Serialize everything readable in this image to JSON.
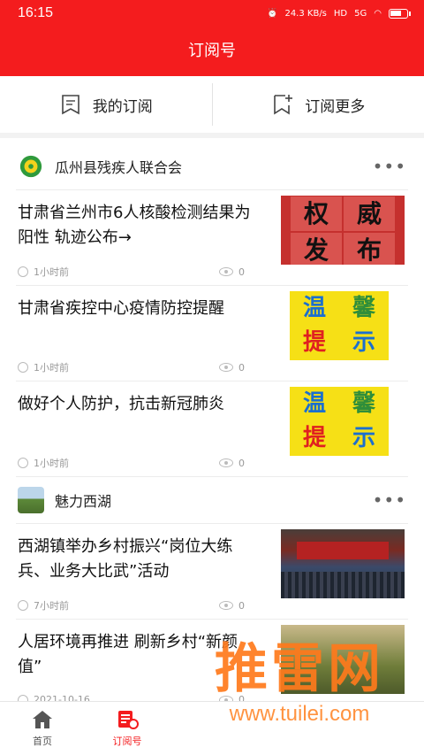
{
  "status_bar": {
    "time": "16:15",
    "net_speed": "24.3 KB/s",
    "hd": "HD",
    "signal": "5G",
    "battery": "76"
  },
  "header": {
    "title": "订阅号"
  },
  "subbar": {
    "my_subscriptions": "我的订阅",
    "subscribe_more": "订阅更多"
  },
  "sources": [
    {
      "name": "瓜州县残疾人联合会",
      "more": "•••",
      "items": [
        {
          "title": "甘肃省兰州市6人核酸检测结果为阳性 轨迹公布→",
          "time": "1小时前",
          "views": "0",
          "thumb_text": [
            "权",
            "威",
            "发",
            "布"
          ]
        },
        {
          "title": "甘肃省疾控中心疫情防控提醒",
          "time": "1小时前",
          "views": "0",
          "thumb_text": [
            "温",
            "馨",
            "提",
            "示"
          ]
        },
        {
          "title": "做好个人防护，抗击新冠肺炎",
          "time": "1小时前",
          "views": "0",
          "thumb_text": [
            "温",
            "馨",
            "提",
            "示"
          ]
        }
      ]
    },
    {
      "name": "魅力西湖",
      "more": "•••",
      "items": [
        {
          "title": "西湖镇举办乡村振兴“岗位大练兵、业务大比武”活动",
          "time": "7小时前",
          "views": "0"
        },
        {
          "title": "人居环境再推进 刷新乡村“新颜值”",
          "time": "2021-10-16",
          "views": "0"
        }
      ]
    }
  ],
  "tabbar": {
    "home": "首页",
    "subscribe": "订阅号"
  },
  "watermark": {
    "text": "推雷网",
    "url": "www.tuilei.com"
  },
  "colors": {
    "brand_red": "#f41c1e",
    "watermark_orange": "#ff7a1c"
  }
}
